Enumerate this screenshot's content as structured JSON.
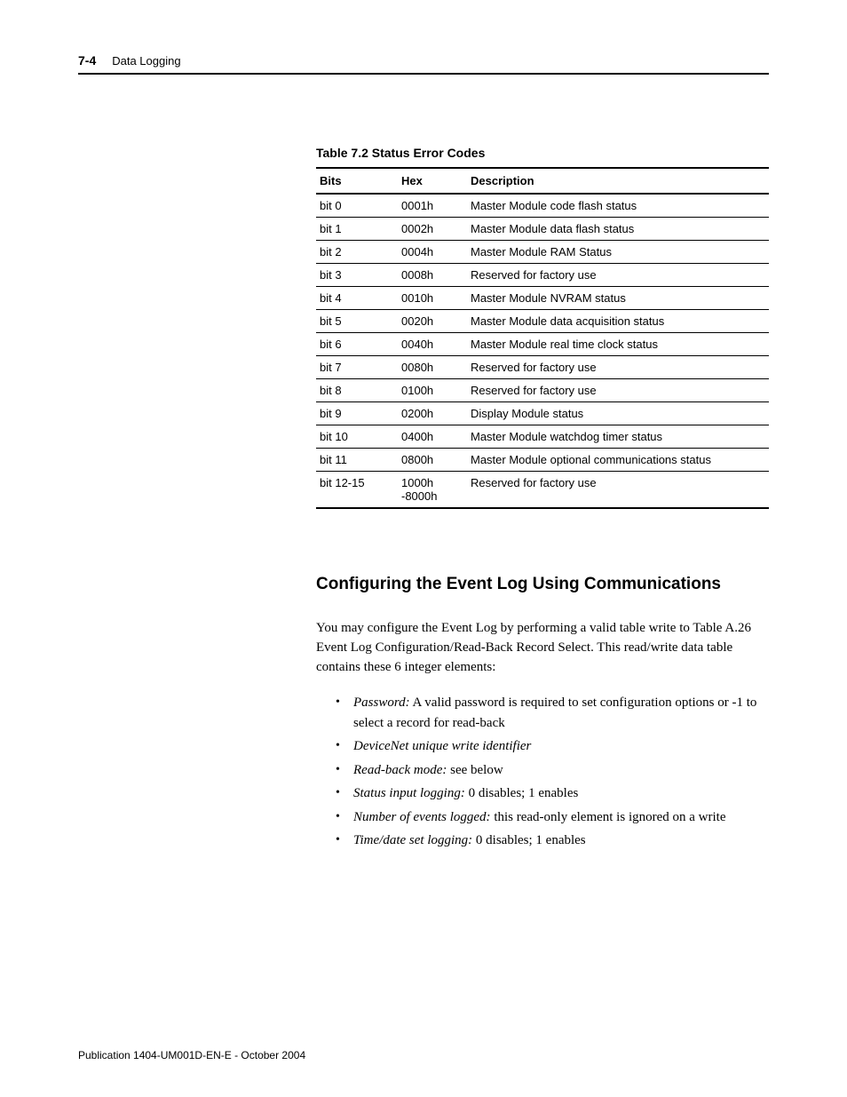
{
  "header": {
    "page_num": "7-4",
    "section_name": "Data Logging"
  },
  "table": {
    "caption": "Table 7.2 Status Error Codes",
    "columns": [
      "Bits",
      "Hex",
      "Description"
    ],
    "rows": [
      {
        "bits": "bit 0",
        "hex": "0001h",
        "desc": "Master Module code flash status"
      },
      {
        "bits": "bit 1",
        "hex": "0002h",
        "desc": "Master Module data flash status"
      },
      {
        "bits": "bit 2",
        "hex": "0004h",
        "desc": "Master Module RAM Status"
      },
      {
        "bits": "bit 3",
        "hex": "0008h",
        "desc": "Reserved for factory use"
      },
      {
        "bits": "bit 4",
        "hex": "0010h",
        "desc": "Master Module NVRAM status"
      },
      {
        "bits": "bit 5",
        "hex": "0020h",
        "desc": "Master Module data acquisition status"
      },
      {
        "bits": "bit 6",
        "hex": "0040h",
        "desc": "Master Module real time clock status"
      },
      {
        "bits": "bit 7",
        "hex": "0080h",
        "desc": "Reserved for factory use"
      },
      {
        "bits": "bit 8",
        "hex": "0100h",
        "desc": "Reserved for factory use"
      },
      {
        "bits": "bit 9",
        "hex": "0200h",
        "desc": "Display Module status"
      },
      {
        "bits": "bit 10",
        "hex": "0400h",
        "desc": "Master Module watchdog timer status"
      },
      {
        "bits": "bit 11",
        "hex": "0800h",
        "desc": "Master Module optional communications status"
      },
      {
        "bits": "bit 12-15",
        "hex": "1000h -8000h",
        "desc": "Reserved for factory use"
      }
    ]
  },
  "heading": "Configuring the Event Log Using Communications",
  "paragraph": "You may configure the Event Log by performing a valid table write to Table A.26 Event Log Configuration/Read-Back Record Select. This read/write data table contains these 6 integer elements:",
  "bullets": [
    {
      "label": "Password:",
      "text": " A valid password is required to set configuration options or -1 to select a record for read-back"
    },
    {
      "label": "DeviceNet unique write identifier",
      "text": ""
    },
    {
      "label": "Read-back mode:",
      "text": " see below"
    },
    {
      "label": "Status input logging:",
      "text": " 0 disables; 1 enables"
    },
    {
      "label": "Number of events logged:",
      "text": " this read-only element is ignored on a write"
    },
    {
      "label": "Time/date set logging:",
      "text": " 0 disables; 1 enables"
    }
  ],
  "footer": "Publication 1404-UM001D-EN-E - October 2004"
}
